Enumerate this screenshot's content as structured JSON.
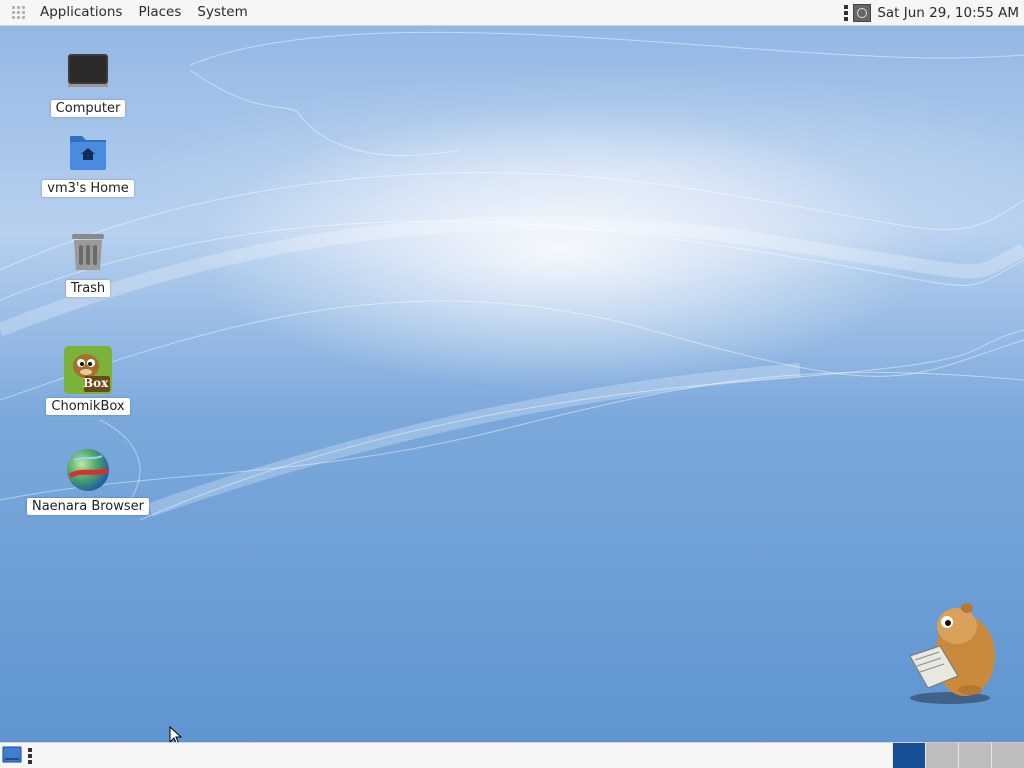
{
  "top_panel": {
    "menus": [
      {
        "label": "Applications"
      },
      {
        "label": "Places"
      },
      {
        "label": "System"
      }
    ],
    "clock": "Sat Jun 29, 10:55 AM",
    "tray_icons": [
      "network-icon"
    ]
  },
  "desktop": {
    "icons": [
      {
        "label": "Computer",
        "icon": "computer-icon"
      },
      {
        "label": "vm3's Home",
        "icon": "home-folder-icon"
      },
      {
        "label": "Trash",
        "icon": "trash-icon"
      },
      {
        "label": "ChomikBox",
        "icon": "chomikbox-icon",
        "badge": "Box"
      },
      {
        "label": "Naenara Browser",
        "icon": "globe-icon"
      }
    ]
  },
  "bottom_panel": {
    "show_desktop_icon": "show-desktop-icon",
    "workspaces": [
      {
        "active": true
      },
      {
        "active": false
      },
      {
        "active": false
      },
      {
        "active": false
      }
    ]
  },
  "colors": {
    "panel_bg": "#f6f6f6",
    "wallpaper_blue": "#6f9fd6",
    "active_workspace": "#164f93",
    "inactive_workspace": "#bdbdbd"
  }
}
